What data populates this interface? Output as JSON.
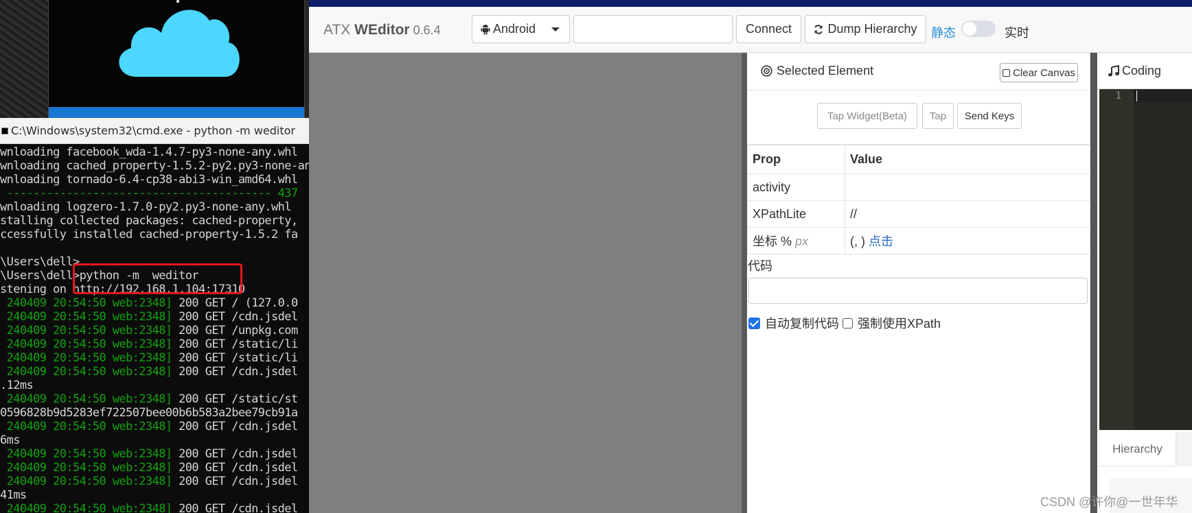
{
  "terminal": {
    "window_title": "C:\\Windows\\system32\\cmd.exe - python  -m  weditor",
    "lines": [
      [
        {
          "t": "wnloading facebook_wda-1.4.7-py3-none-any.whl",
          "c": ""
        }
      ],
      [
        {
          "t": "wnloading cached_property-1.5.2-py2.py3-none-any.whl",
          "c": ""
        }
      ],
      [
        {
          "t": "wnloading tornado-6.4-cp38-abi3-win_amd64.whl",
          "c": ""
        }
      ],
      [
        {
          "t": " ---------------------------------------- 437",
          "c": "g"
        }
      ],
      [
        {
          "t": "wnloading logzero-1.7.0-py2.py3-none-any.whl",
          "c": ""
        }
      ],
      [
        {
          "t": "stalling collected packages: cached-property, ",
          "c": ""
        }
      ],
      [
        {
          "t": "ccessfully installed cached-property-1.5.2 fa",
          "c": ""
        }
      ],
      [
        {
          "t": "",
          "c": ""
        }
      ],
      [
        {
          "t": "\\Users\\dell>",
          "c": ""
        }
      ],
      [
        {
          "t": "\\Users\\dell>python -m  weditor",
          "c": ""
        }
      ],
      [
        {
          "t": "stening on http://192.168.1.104:17310",
          "c": ""
        }
      ],
      [
        {
          "t": " 240409 20:54:50 web:2348]",
          "c": "g"
        },
        {
          "t": " 200 GET / (127.0.0",
          "c": ""
        }
      ],
      [
        {
          "t": " 240409 20:54:50 web:2348]",
          "c": "g"
        },
        {
          "t": " 200 GET /cdn.jsdel",
          "c": ""
        }
      ],
      [
        {
          "t": " 240409 20:54:50 web:2348]",
          "c": "g"
        },
        {
          "t": " 200 GET /unpkg.com",
          "c": ""
        }
      ],
      [
        {
          "t": " 240409 20:54:50 web:2348]",
          "c": "g"
        },
        {
          "t": " 200 GET /static/li",
          "c": ""
        }
      ],
      [
        {
          "t": " 240409 20:54:50 web:2348]",
          "c": "g"
        },
        {
          "t": " 200 GET /static/li",
          "c": ""
        }
      ],
      [
        {
          "t": " 240409 20:54:50 web:2348]",
          "c": "g"
        },
        {
          "t": " 200 GET /cdn.jsdel",
          "c": ""
        }
      ],
      [
        {
          "t": ".12ms",
          "c": ""
        }
      ],
      [
        {
          "t": " 240409 20:54:50 web:2348]",
          "c": "g"
        },
        {
          "t": " 200 GET /static/st",
          "c": ""
        }
      ],
      [
        {
          "t": "0596828b9d5283ef722507bee00b6b583a2bee79cb91a",
          "c": ""
        }
      ],
      [
        {
          "t": " 240409 20:54:50 web:2348]",
          "c": "g"
        },
        {
          "t": " 200 GET /cdn.jsdel",
          "c": ""
        }
      ],
      [
        {
          "t": "6ms",
          "c": ""
        }
      ],
      [
        {
          "t": " 240409 20:54:50 web:2348]",
          "c": "g"
        },
        {
          "t": " 200 GET /cdn.jsdel",
          "c": ""
        }
      ],
      [
        {
          "t": " 240409 20:54:50 web:2348]",
          "c": "g"
        },
        {
          "t": " 200 GET /cdn.jsdel",
          "c": ""
        }
      ],
      [
        {
          "t": " 240409 20:54:50 web:2348]",
          "c": "g"
        },
        {
          "t": " 200 GET /cdn.jsdel",
          "c": ""
        }
      ],
      [
        {
          "t": "41ms",
          "c": ""
        }
      ],
      [
        {
          "t": " 240409 20:54:50 web:2348]",
          "c": "g"
        },
        {
          "t": " 200 GET /cdn.jsdel",
          "c": ""
        }
      ]
    ]
  },
  "navbar": {
    "brand_prefix": "ATX ",
    "brand_name": "WEditor",
    "version": " 0.6.4",
    "platform": "Android",
    "device_placeholder": "",
    "connect_label": "Connect",
    "dump_label": "Dump Hierarchy",
    "mode_static": "静态",
    "mode_live": "实时"
  },
  "props": {
    "title": "Selected Element",
    "clear_canvas": "Clear Canvas",
    "tap_widget": "Tap Widget(Beta)",
    "tap": "Tap",
    "send_keys": "Send Keys",
    "col_prop": "Prop",
    "col_value": "Value",
    "row_activity": "activity",
    "row_activity_value": "",
    "row_xpath": "XPathLite",
    "row_xpath_value": "//",
    "row_coord": "坐标",
    "row_coord_pct": "%",
    "row_coord_px": "px",
    "row_coord_value": "(, )",
    "row_coord_link": "点击",
    "code_label": "代码",
    "auto_copy": "自动复制代码",
    "force_xpath": "强制使用XPath"
  },
  "coding": {
    "title": "Coding",
    "line_number": "1",
    "hierarchy_tab": "Hierarchy"
  },
  "watermark": "CSDN @许你@一世年华",
  "colors": {
    "terminal_bg": "#0c0c0c",
    "terminal_green": "#13a10e",
    "cloud": "#4dd6ff",
    "accent_bar": "#0a1d6b",
    "link_blue": "#2b6cc4",
    "highlight_red": "#e6161c"
  }
}
